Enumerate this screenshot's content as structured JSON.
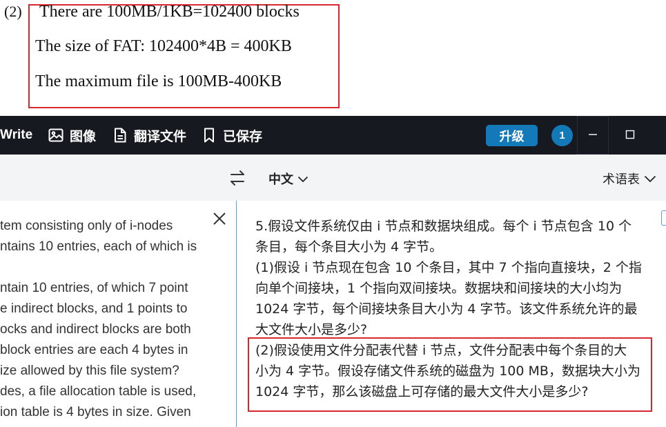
{
  "document": {
    "item_number": "(2)",
    "lines": [
      "There are 100MB/1KB=102400 blocks",
      "The size of FAT: 102400*4B = 400KB",
      "The maximum file is 100MB-400KB"
    ],
    "highlight_color": "#d8262f"
  },
  "toolbar": {
    "write_label": "Write",
    "image_label": "图像",
    "translate_file_label": "翻译文件",
    "saved_label": "已保存",
    "upgrade_label": "升级",
    "notification_count": "1",
    "background_color": "#161a20",
    "accent_color": "#1479b8"
  },
  "language_bar": {
    "target_language": "中文",
    "glossary_label": "术语表"
  },
  "source_panel": {
    "lines": [
      "tem consisting only of i-nodes",
      "ntains 10 entries, each of which is",
      "",
      "ntain 10 entries, of which 7 point",
      "e indirect blocks, and 1 points to",
      "ocks and indirect blocks are both",
      "block entries are each 4 bytes in",
      "ize allowed by this file system?",
      "des, a file allocation table is used,",
      "ion table is 4 bytes in size. Given"
    ]
  },
  "translation_panel": {
    "lines": [
      "5.假设文件系统仅由 i 节点和数据块组成。每个 i 节点包含 10 个",
      "条目，每个条目大小为 4 字节。",
      "(1)假设 i 节点现在包含 10 个条目，其中 7 个指向直接块，2 个指",
      "向单个间接块，1 个指向双间接块。数据块和间接块的大小均为",
      "1024 字节，每个间接块条目大小为 4 字节。该文件系统允许的最",
      "大文件大小是多少?",
      "(2)假设使用文件分配表代替 i 节点，文件分配表中每个条目的大",
      "小为 4 字节。假设存储文件系统的磁盘为 100 MB，数据块大小为",
      "1024 字节，那么该磁盘上可存储的最大文件大小是多少?"
    ]
  }
}
